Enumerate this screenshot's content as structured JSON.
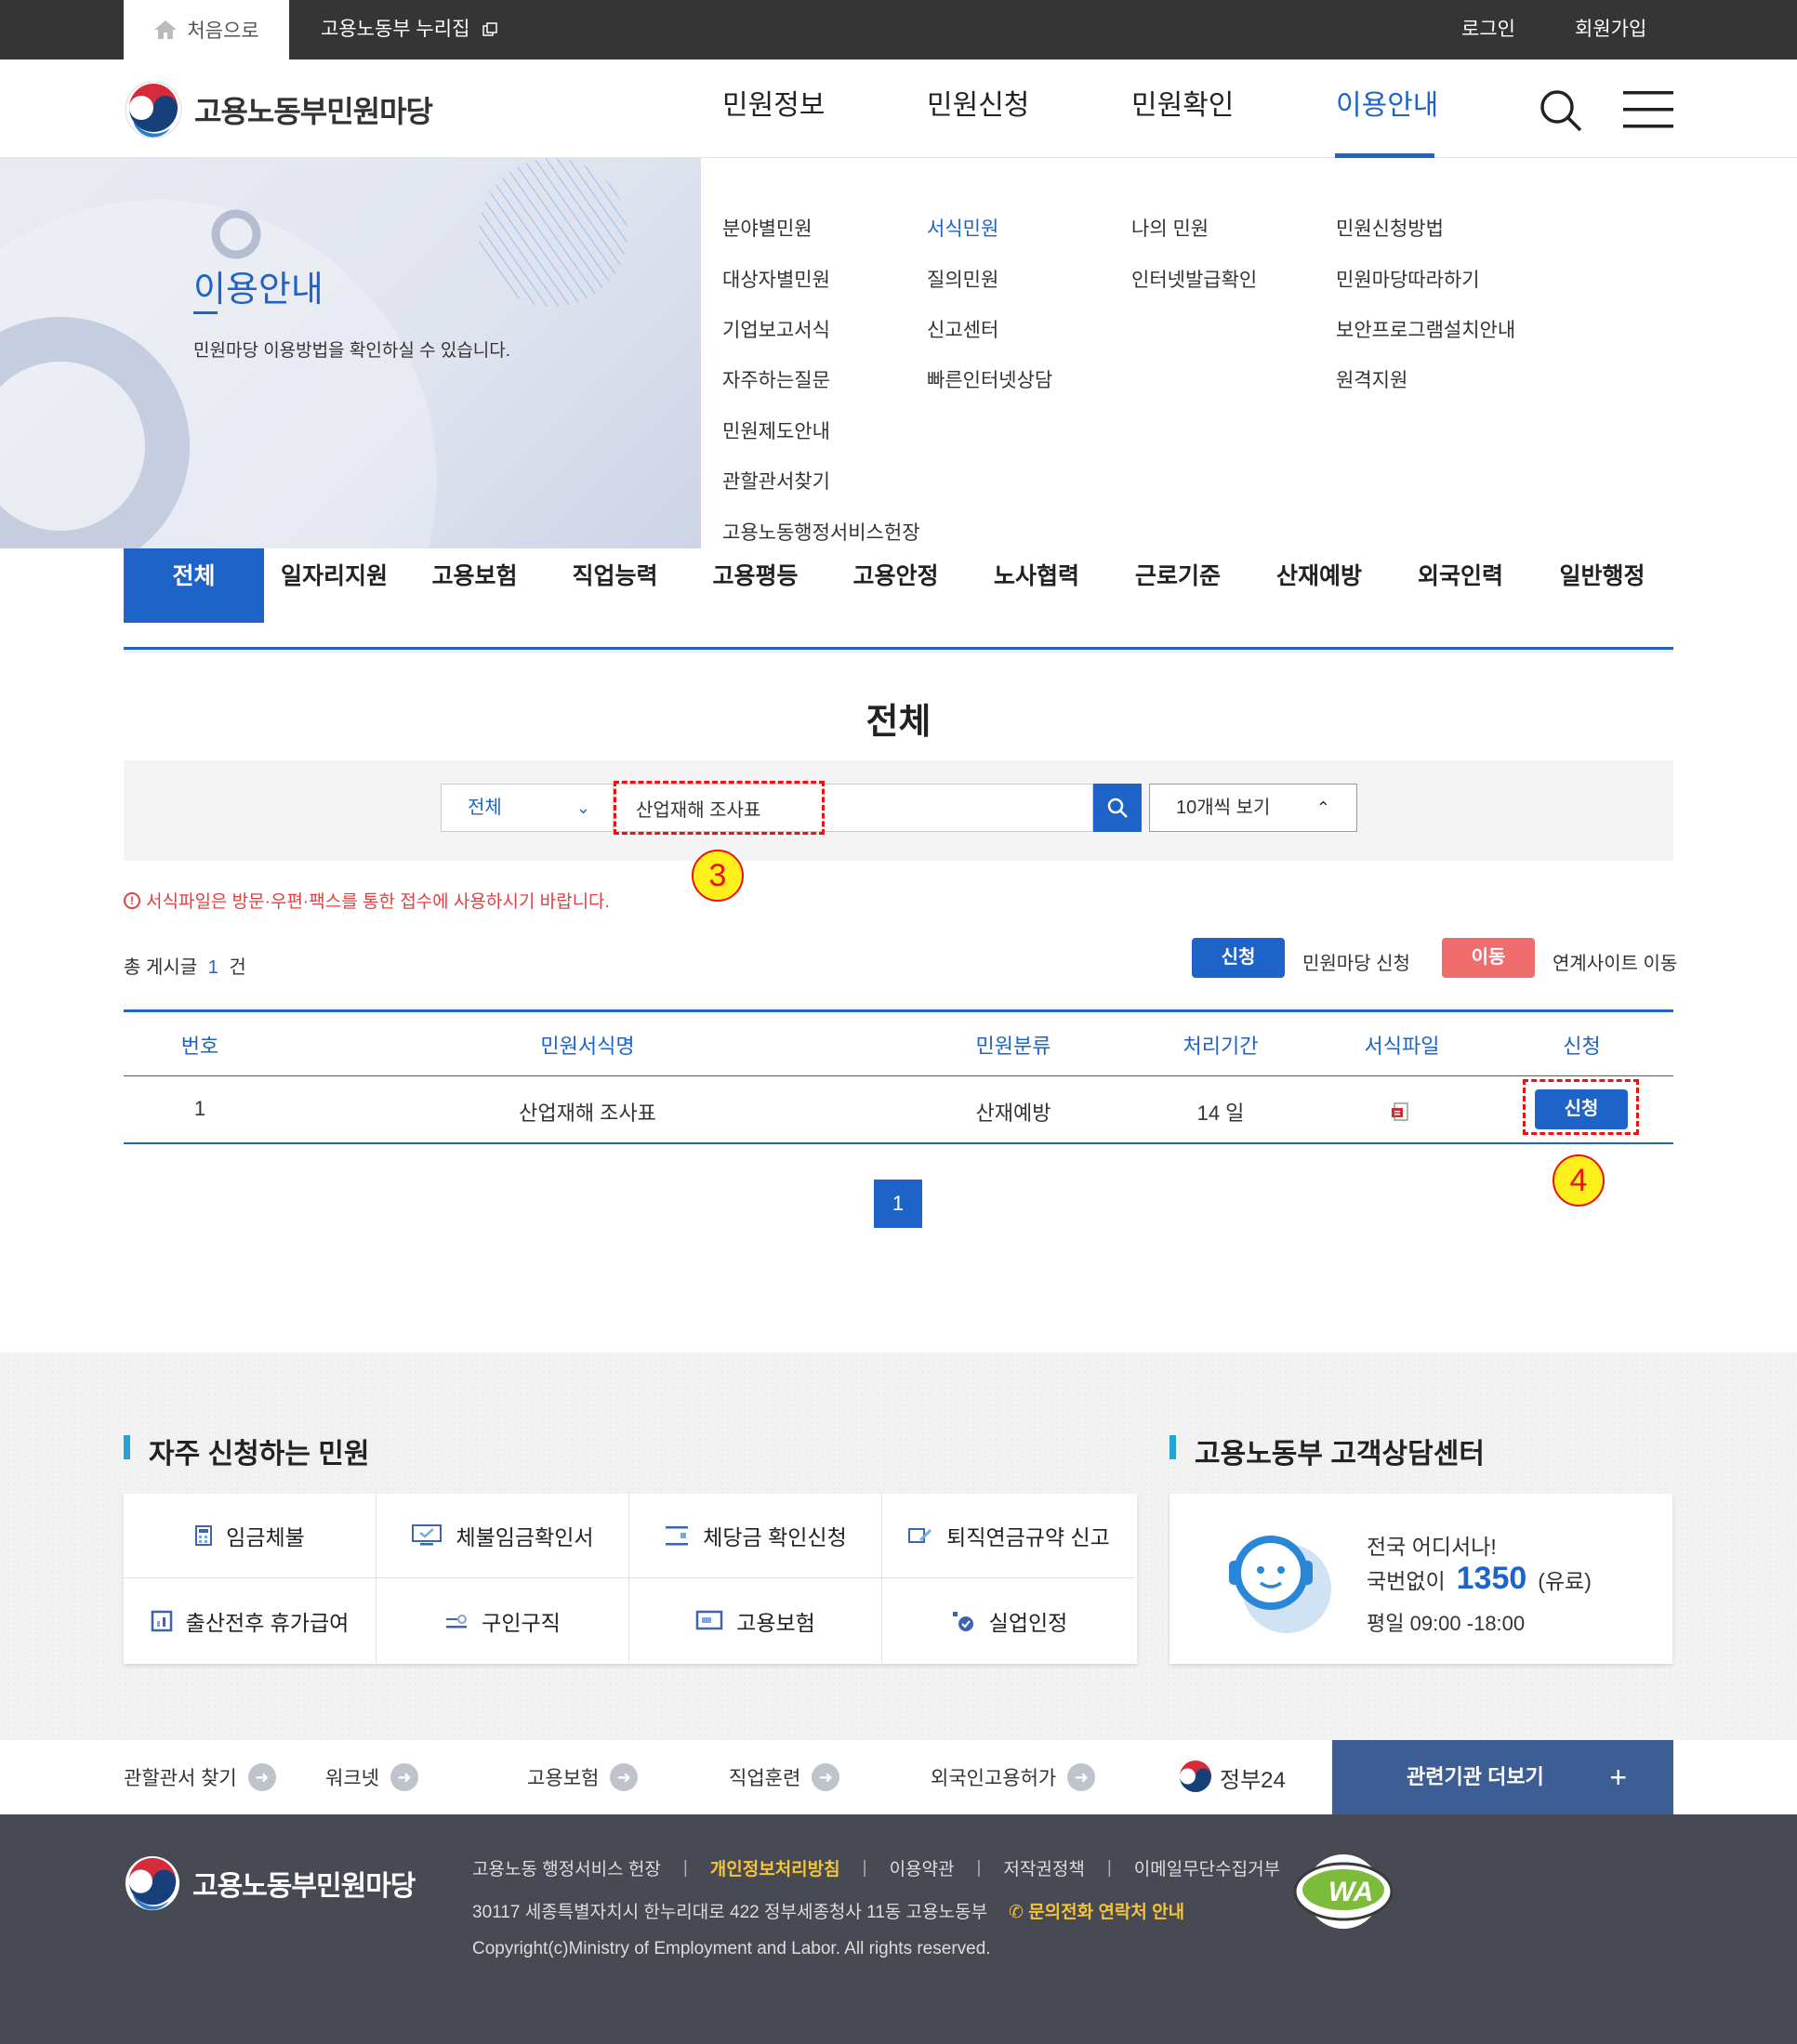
{
  "topbar": {
    "home": "처음으로",
    "nurizip": "고용노동부 누리집",
    "login": "로그인",
    "signup": "회원가입"
  },
  "header": {
    "site_title": "고용노동부민원마당",
    "nav": [
      "민원정보",
      "민원신청",
      "민원확인",
      "이용안내"
    ]
  },
  "visual": {
    "title": "이용안내",
    "desc": "민원마당 이용방법을 확인하실 수 있습니다."
  },
  "dropdown": {
    "col1": [
      "분야별민원",
      "대상자별민원",
      "기업보고서식",
      "자주하는질문",
      "민원제도안내",
      "관할관서찾기",
      "고용노동행정서비스헌장"
    ],
    "col2": [
      "서식민원",
      "질의민원",
      "신고센터",
      "빠른인터넷상담"
    ],
    "col3": [
      "나의 민원",
      "인터넷발급확인"
    ],
    "col4": [
      "민원신청방법",
      "민원마당따라하기",
      "보안프로그램설치안내",
      "원격지원"
    ]
  },
  "tabs": [
    "전체",
    "일자리지원",
    "고용보험",
    "직업능력",
    "고용평등",
    "고용안정",
    "노사협력",
    "근로기준",
    "산재예방",
    "외국인력",
    "일반행정"
  ],
  "page_title": "전체",
  "search": {
    "category": "전체",
    "query": "산업재해 조사표",
    "per_page": "10개씩 보기"
  },
  "annotations": {
    "step3": "3",
    "step4": "4"
  },
  "notice": "서식파일은 방문·우편·팩스를 통한 접수에 사용하시기 바랍니다.",
  "total": {
    "label": "총 게시글",
    "count": "1",
    "unit": "건"
  },
  "legend": {
    "apply_btn": "신청",
    "apply_text": "민원마당 신청",
    "move_btn": "이동",
    "move_text": "연계사이트 이동"
  },
  "table": {
    "headers": [
      "번호",
      "민원서식명",
      "민원분류",
      "처리기간",
      "서식파일",
      "신청"
    ],
    "rows": [
      {
        "no": "1",
        "name": "산업재해 조사표",
        "category": "산재예방",
        "period": "14 일",
        "action": "신청"
      }
    ]
  },
  "pagination": {
    "current": "1"
  },
  "frequent": {
    "title": "자주 신청하는 민원",
    "items": [
      "임금체불",
      "체불임금확인서",
      "체당금 확인신청",
      "퇴직연금규약 신고",
      "출산전후 휴가급여",
      "구인구직",
      "고용보험",
      "실업인정"
    ]
  },
  "center": {
    "title": "고용노동부 고객상담센터",
    "line1": "전국 어디서나!",
    "line2_pre": "국번없이",
    "number": "1350",
    "line2_post": "(유료)",
    "hours": "평일 09:00 -18:00"
  },
  "related": {
    "links": [
      "관할관서 찾기",
      "워크넷",
      "고용보험",
      "직업훈련",
      "외국인고용허가",
      "정부24"
    ],
    "more": "관련기관 더보기"
  },
  "footer": {
    "site_title": "고용노동부민원마당",
    "links": [
      "고용노동 행정서비스 헌장",
      "개인정보처리방침",
      "이용약관",
      "저작권정책",
      "이메일무단수집거부"
    ],
    "address": "30117 세종특별자치시 한누리대로 422 정부세종청사 11동 고용노동부",
    "tel": "문의전화 연락처 안내",
    "copyright": "Copyright(c)Ministry of Employment and Labor. All rights reserved.",
    "wa_text": "WA"
  },
  "colors": {
    "primary": "#1e64c8",
    "red": "#e04040",
    "accent": "#27a1d6",
    "footer": "#474a52"
  }
}
